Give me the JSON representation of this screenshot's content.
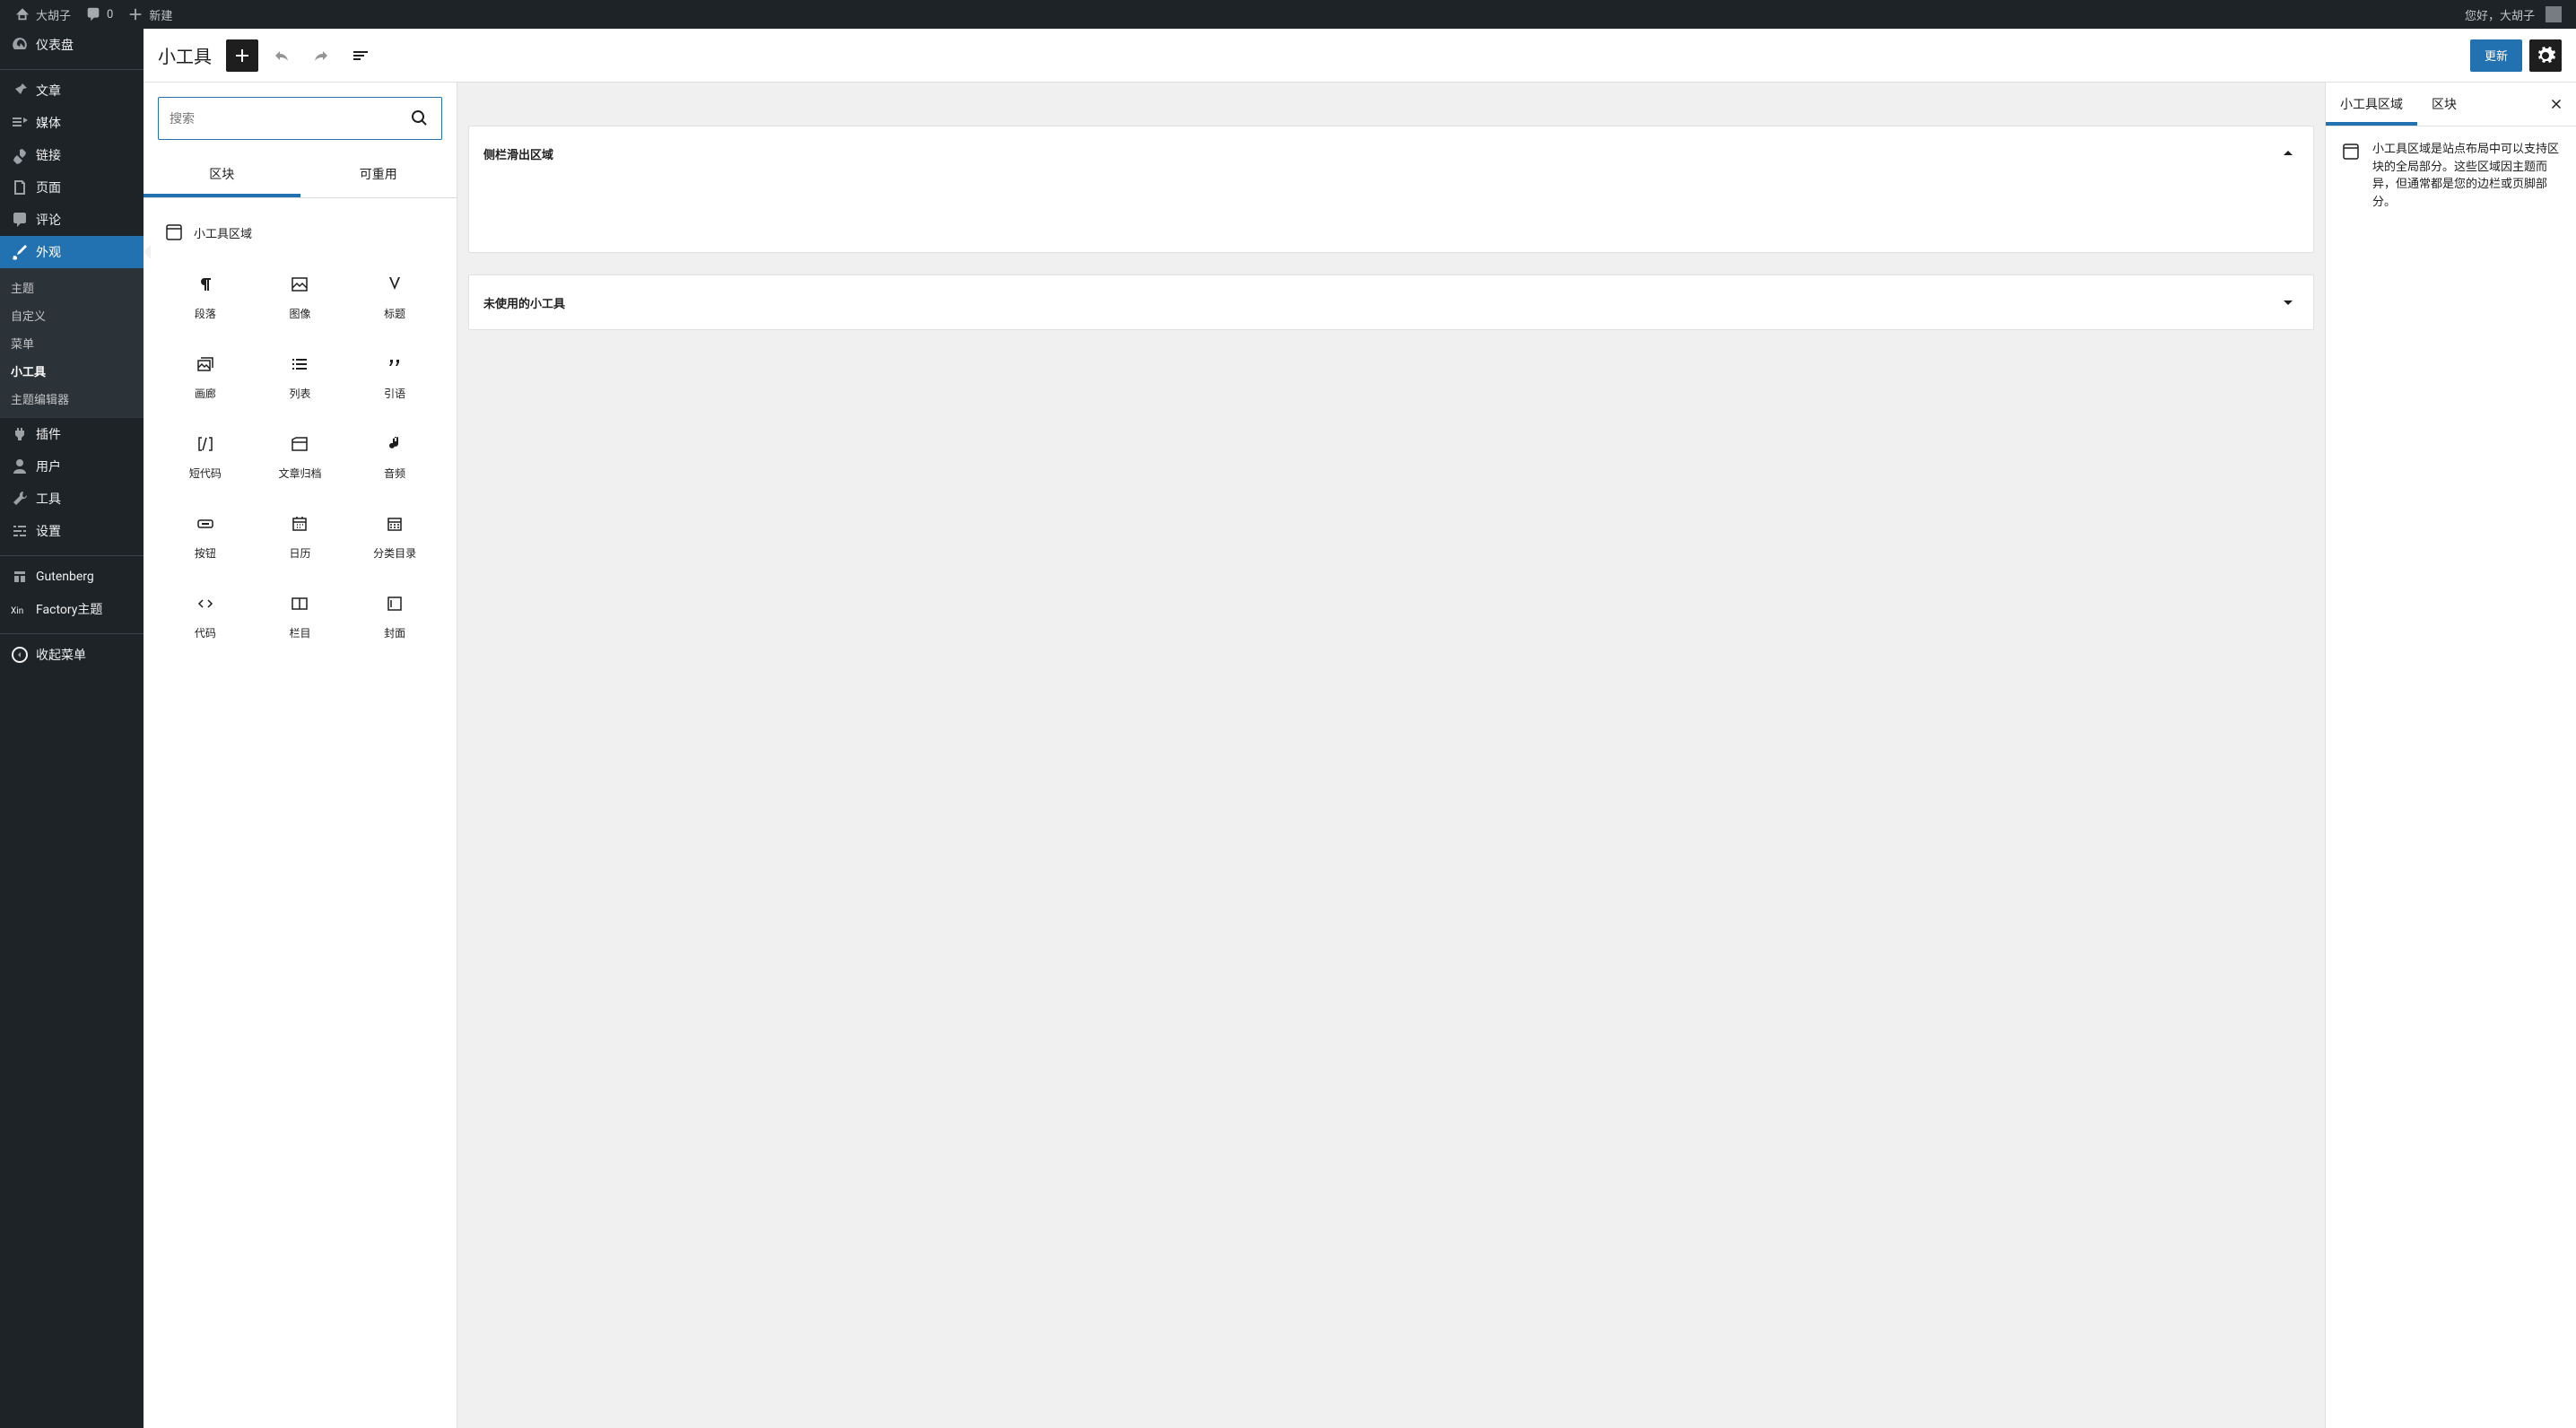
{
  "adminbar": {
    "site": "大胡子",
    "comments": "0",
    "new": "新建",
    "greeting": "您好，大胡子"
  },
  "sidebar": {
    "dashboard": "仪表盘",
    "posts": "文章",
    "media": "媒体",
    "links": "链接",
    "pages": "页面",
    "comments": "评论",
    "appearance": "外观",
    "sub_themes": "主题",
    "sub_customize": "自定义",
    "sub_menus": "菜单",
    "sub_widgets": "小工具",
    "sub_editor": "主题编辑器",
    "plugins": "插件",
    "users": "用户",
    "tools": "工具",
    "settings": "设置",
    "gutenberg": "Gutenberg",
    "factory": "Factory主题",
    "collapse": "收起菜单"
  },
  "header": {
    "title": "小工具",
    "update": "更新"
  },
  "inserter": {
    "search_placeholder": "搜索",
    "tab_blocks": "区块",
    "tab_reusable": "可重用",
    "category": "小工具区域",
    "blocks": {
      "paragraph": "段落",
      "image": "图像",
      "heading": "标题",
      "gallery": "画廊",
      "list": "列表",
      "quote": "引语",
      "shortcode": "短代码",
      "archives": "文章归档",
      "audio": "音频",
      "button": "按钮",
      "calendar": "日历",
      "categories": "分类目录",
      "code": "代码",
      "columns": "栏目",
      "cover": "封面"
    }
  },
  "canvas": {
    "area1": "侧栏滑出区域",
    "area2": "未使用的小工具"
  },
  "settings": {
    "tab_area": "小工具区域",
    "tab_block": "区块",
    "desc": "小工具区域是站点布局中可以支持区块的全局部分。这些区域因主题而异，但通常都是您的边栏或页脚部分。"
  }
}
